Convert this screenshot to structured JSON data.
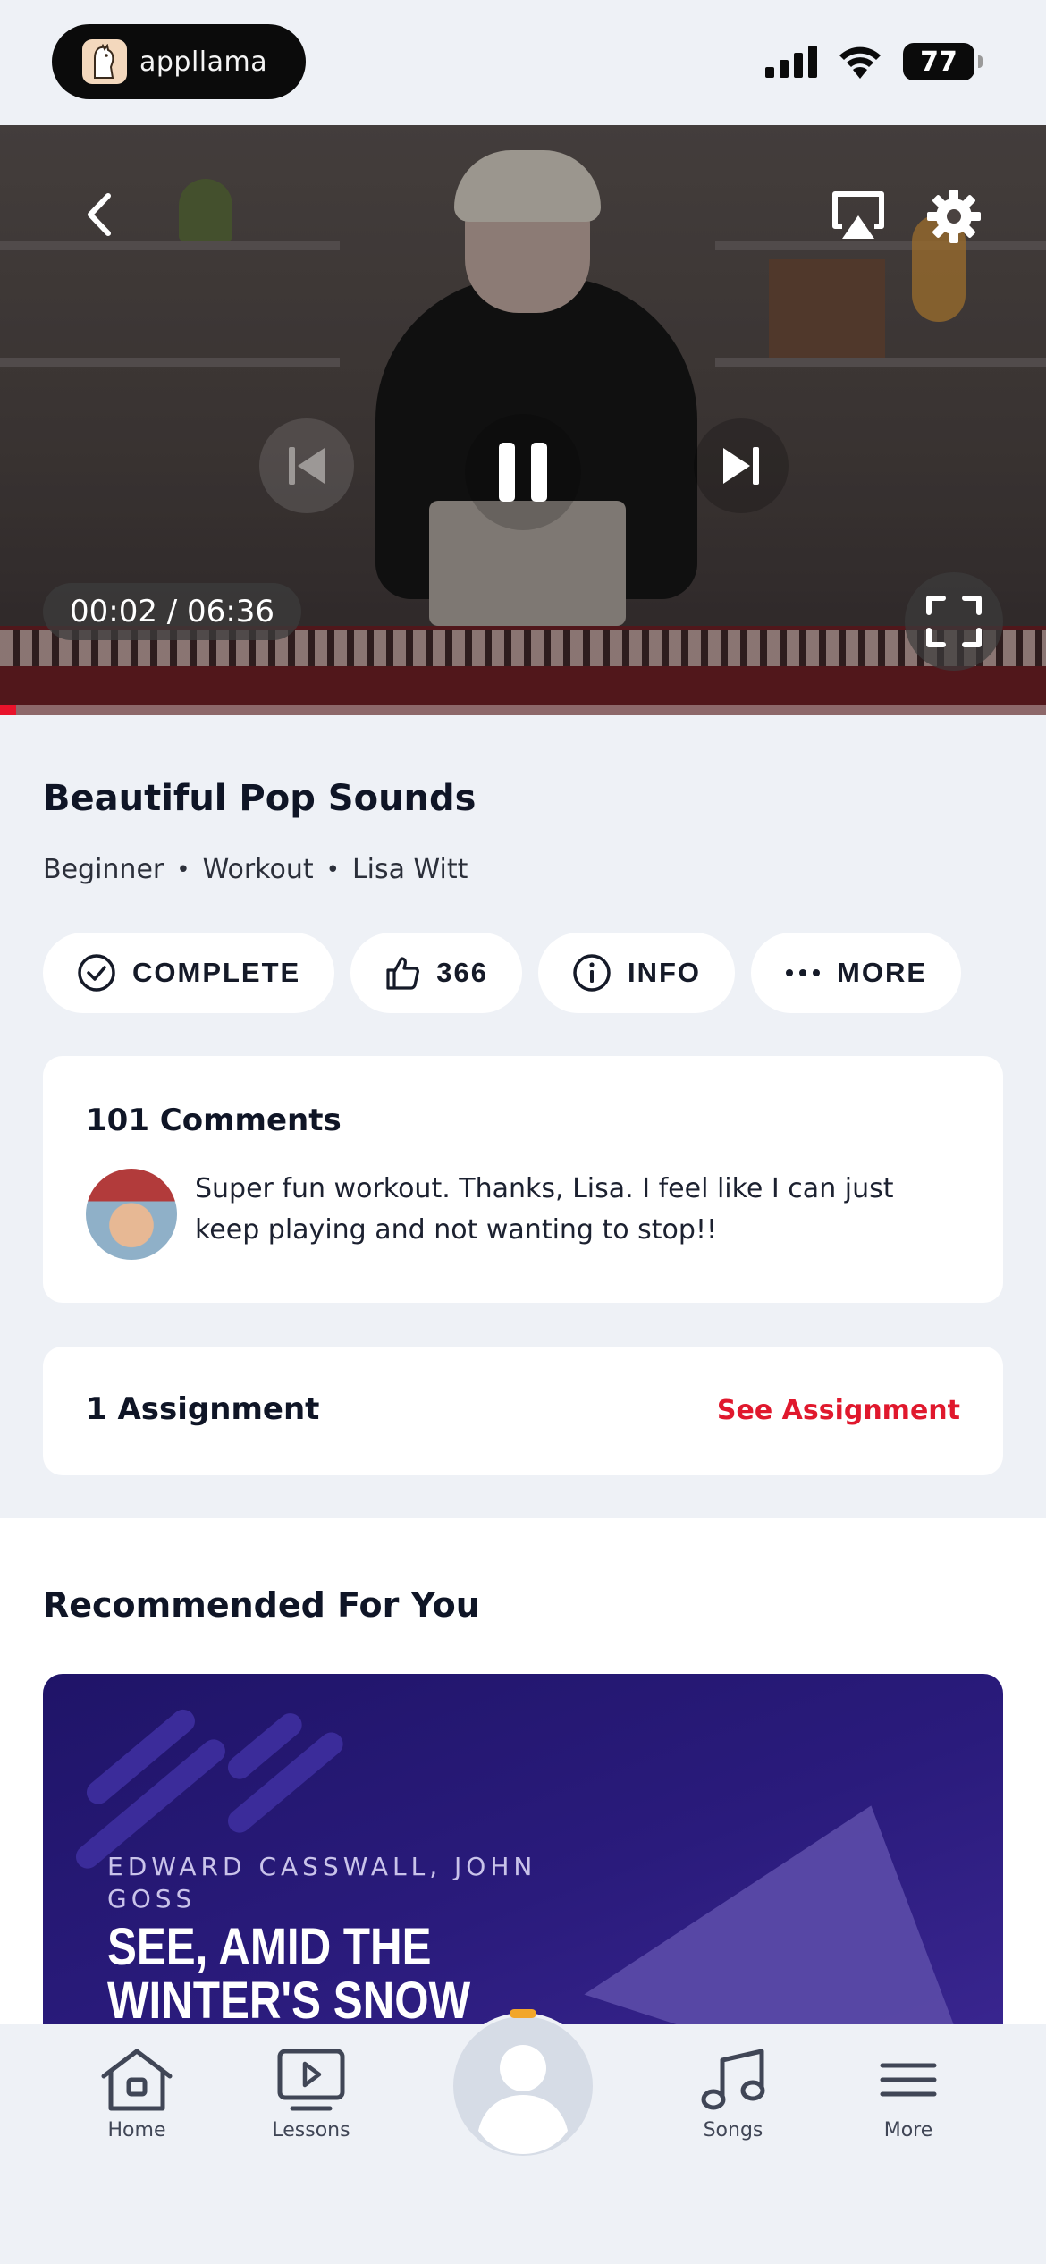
{
  "status_bar": {
    "app_name": "appllama",
    "battery": "77"
  },
  "player": {
    "timecode": "00:02 / 06:36",
    "progress": 0.005,
    "accent_color": "#e8132b"
  },
  "lesson": {
    "title": "Beautiful Pop Sounds",
    "meta": [
      "Beginner",
      "Workout",
      "Lisa Witt"
    ],
    "separator": "•"
  },
  "actions": {
    "complete": "COMPLETE",
    "likes": "366",
    "info": "INFO",
    "more": "MORE"
  },
  "comments": {
    "title": "101 Comments",
    "text": "Super fun workout. Thanks, Lisa. I feel like I can just keep playing and not wanting to stop!!"
  },
  "assignment": {
    "title": "1 Assignment",
    "link": "See Assignment",
    "link_color": "#e0182d"
  },
  "recommended": {
    "title": "Recommended For You",
    "card": {
      "subtitle": "EDWARD CASSWALL, JOHN GOSS",
      "song": "SEE, AMID THE WINTER'S SNOW (LEAD SHEET)"
    }
  },
  "tabbar": {
    "home": "Home",
    "lessons": "Lessons",
    "songs": "Songs",
    "more": "More"
  }
}
